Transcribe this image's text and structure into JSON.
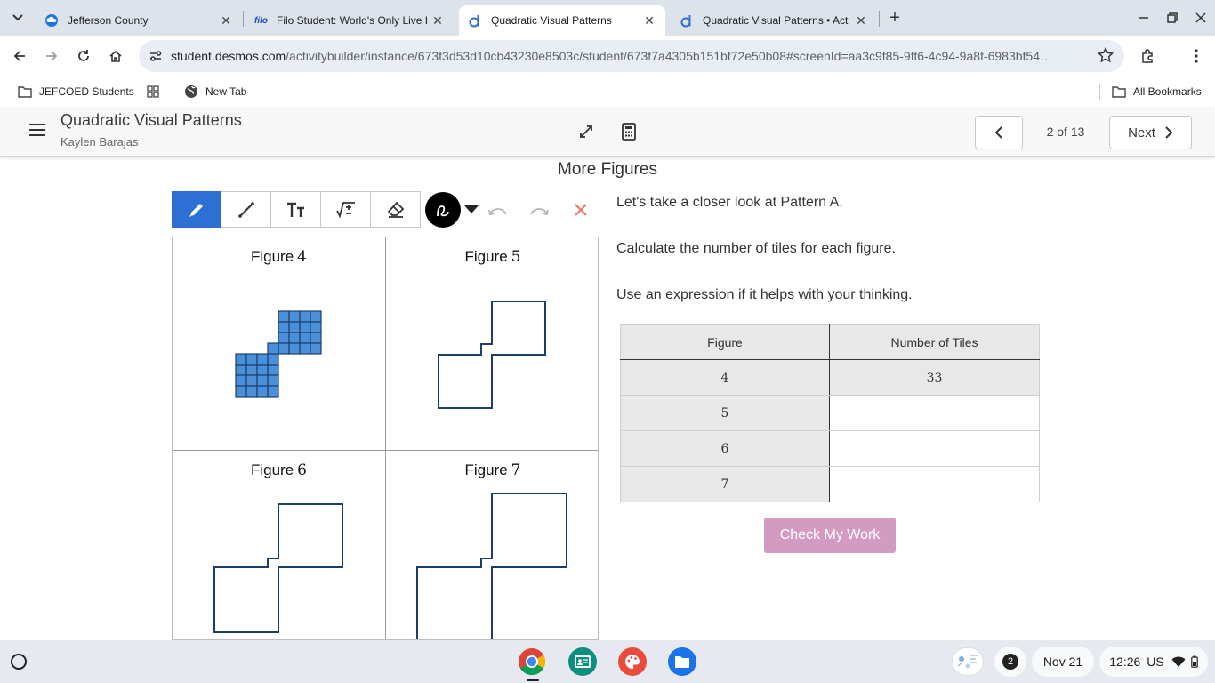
{
  "browser": {
    "tabs": [
      {
        "title": "Jefferson County",
        "active": false
      },
      {
        "title": "Filo Student: World's Only Live I",
        "active": false
      },
      {
        "title": "Quadratic Visual Patterns",
        "active": true
      },
      {
        "title": "Quadratic Visual Patterns • Act",
        "active": false
      }
    ],
    "url_host": "student.desmos.com",
    "url_path": "/activitybuilder/instance/673f3d53d10cb43230e8503c/student/673f7a4305b151bf72e50b08#screenId=aa3c9f85-9ff6-4c94-9a8f-6983bf54…",
    "bookmarks": [
      {
        "label": "JEFCOED Students"
      },
      {
        "label": "New Tab"
      }
    ],
    "all_bookmarks": "All Bookmarks"
  },
  "app": {
    "title": "Quadratic Visual Patterns",
    "student": "Kaylen Barajas",
    "screen_counter": "2 of 13",
    "next_label": "Next"
  },
  "screen": {
    "title": "More Figures",
    "figures": [
      {
        "word": "Figure",
        "num": "4"
      },
      {
        "word": "Figure",
        "num": "5"
      },
      {
        "word": "Figure",
        "num": "6"
      },
      {
        "word": "Figure",
        "num": "7"
      }
    ],
    "instructions": [
      "Let's take a closer look at Pattern A.",
      "Calculate the number of tiles for each figure.",
      "Use an expression if it helps with your thinking."
    ],
    "table": {
      "headers": [
        "Figure",
        "Number of Tiles"
      ],
      "rows": [
        {
          "figure": "4",
          "tiles": "33"
        },
        {
          "figure": "5",
          "tiles": ""
        },
        {
          "figure": "6",
          "tiles": ""
        },
        {
          "figure": "7",
          "tiles": ""
        }
      ]
    },
    "check_label": "Check My Work"
  },
  "shelf": {
    "notification_count": "2",
    "date": "Nov 21",
    "time": "12:26",
    "locale": "US"
  },
  "colors": {
    "tile_fill": "#4a90d9",
    "figure_stroke": "#1b3f6b",
    "accent_blue": "#2d6fd2",
    "check_button": "#d39bc1",
    "clear_red": "#e8756a"
  },
  "icons": [
    "desmos-logo-icon",
    "filo-logo-icon",
    "pencil-icon",
    "line-icon",
    "text-icon",
    "math-icon",
    "eraser-icon",
    "undo-icon",
    "redo-icon",
    "clear-icon",
    "fullscreen-icon",
    "calculator-icon",
    "chevron-left-icon",
    "chevron-right-icon"
  ]
}
